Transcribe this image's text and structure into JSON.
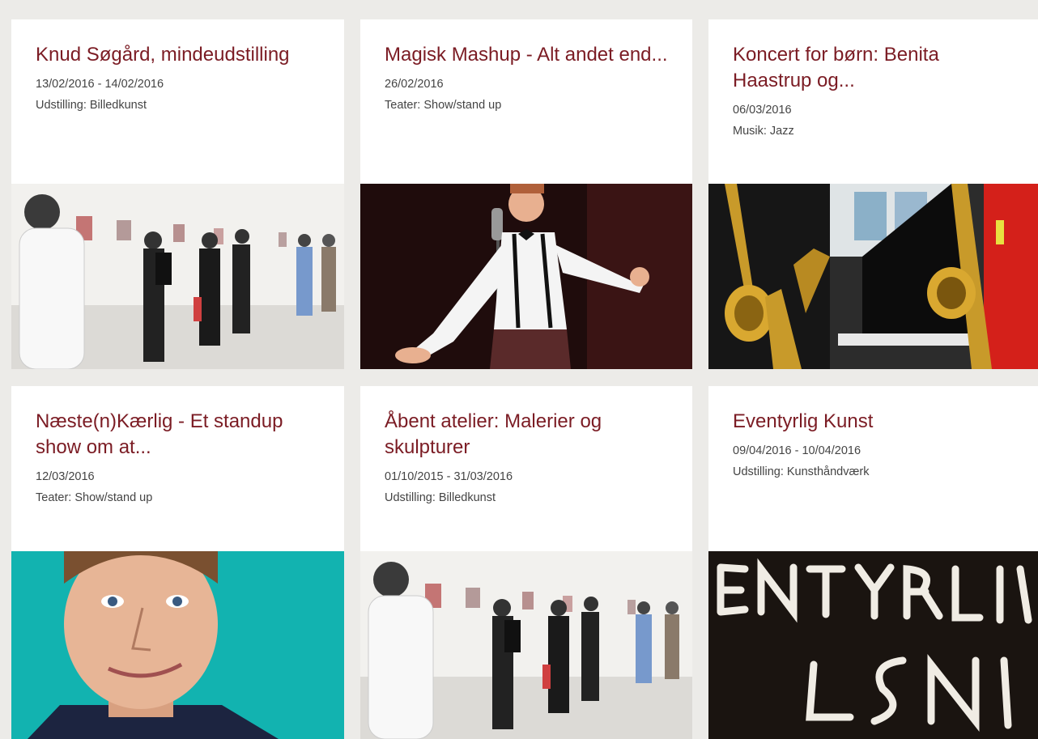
{
  "events": [
    {
      "title": "Knud Søgård, mindeudstilling",
      "date": "13/02/2016 - 14/02/2016",
      "category": "Udstilling: Billedkunst",
      "image_icon": "gallery-exhibition-photo"
    },
    {
      "title": "Magisk Mashup - Alt andet end...",
      "date": "26/02/2016",
      "category": "Teater: Show/stand up",
      "image_icon": "performer-on-stage-photo"
    },
    {
      "title": "Koncert for børn: Benita Haastrup og...",
      "date": "06/03/2016",
      "category": "Musik: Jazz",
      "image_icon": "saxophones-and-piano-photo"
    },
    {
      "title": "Næste(n)Kærlig - Et standup show om at...",
      "date": "12/03/2016",
      "category": "Teater: Show/stand up",
      "image_icon": "comedian-portrait-photo"
    },
    {
      "title": "Åbent atelier: Malerier og skulpturer",
      "date": "01/10/2015 - 31/03/2016",
      "category": "Udstilling: Billedkunst",
      "image_icon": "gallery-exhibition-photo"
    },
    {
      "title": "Eventyrlig Kunst",
      "date": "09/04/2016 - 10/04/2016",
      "category": "Udstilling: Kunsthåndværk",
      "image_icon": "painted-lettering-photo"
    }
  ],
  "colors": {
    "background": "#ecebe8",
    "card": "#ffffff",
    "title": "#7b1c24",
    "meta": "#444444",
    "teal": "#12b3b0"
  }
}
